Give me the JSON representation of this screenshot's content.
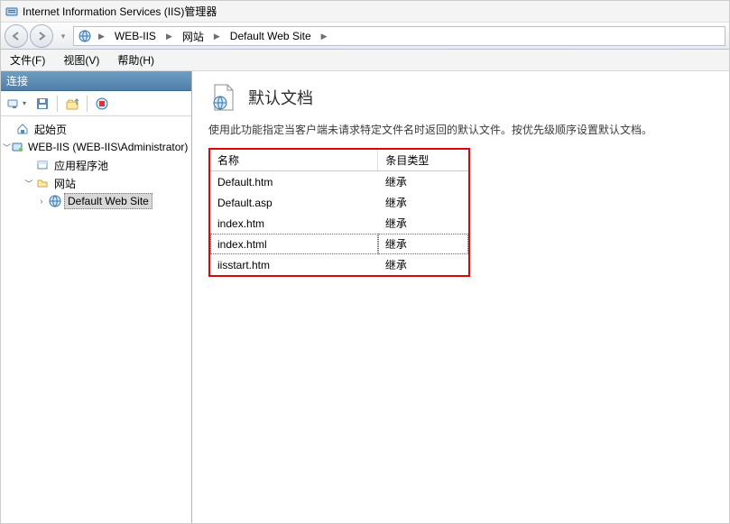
{
  "titlebar": {
    "title": "Internet Information Services (IIS)管理器"
  },
  "breadcrumb": {
    "items": [
      "WEB-IIS",
      "网站",
      "Default Web Site"
    ]
  },
  "menubar": {
    "file": "文件(F)",
    "view": "视图(V)",
    "help": "帮助(H)"
  },
  "sidebar": {
    "header": "连接",
    "tree": {
      "startpage": "起始页",
      "server": "WEB-IIS (WEB-IIS\\Administrator)",
      "apppools": "应用程序池",
      "sites": "网站",
      "defaultsite": "Default Web Site"
    }
  },
  "main": {
    "title": "默认文档",
    "description": "使用此功能指定当客户端未请求特定文件名时返回的默认文件。按优先级顺序设置默认文档。",
    "columns": {
      "name": "名称",
      "entrytype": "条目类型"
    },
    "rows": [
      {
        "name": "Default.htm",
        "entrytype": "继承",
        "selected": false
      },
      {
        "name": "Default.asp",
        "entrytype": "继承",
        "selected": false
      },
      {
        "name": "index.htm",
        "entrytype": "继承",
        "selected": false
      },
      {
        "name": "index.html",
        "entrytype": "继承",
        "selected": true
      },
      {
        "name": "iisstart.htm",
        "entrytype": "继承",
        "selected": false
      }
    ]
  }
}
